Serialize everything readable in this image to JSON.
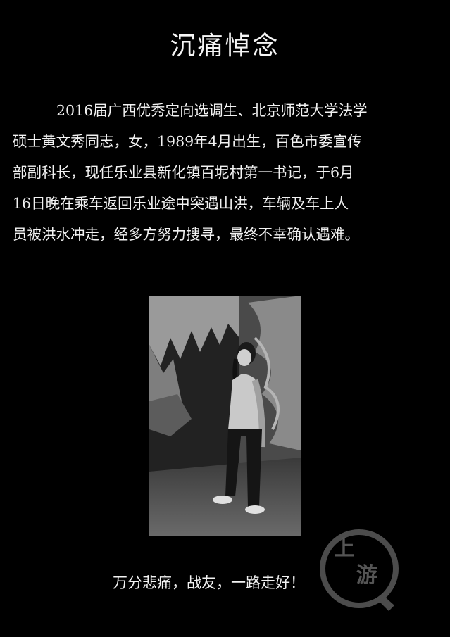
{
  "title": "沉痛悼念",
  "body": {
    "lines": [
      "2016届广西优秀定向选调生、北京师范大学法学",
      "硕士黄文秀同志，女，1989年4月出生，百色市委宣传",
      "部副科长，现任乐业县新化镇百坭村第一书记，于6月",
      "16日晚在乘车返回乐业途中突遇山洪，车辆及车上人",
      "员被洪水冲走，经多方努力搜寻，最终不幸确认遇难。"
    ]
  },
  "photo": {
    "icon": "memorial-photo"
  },
  "closing": "万分悲痛，战友，一路走好！",
  "watermark": {
    "char1": "上",
    "char2": "游"
  }
}
